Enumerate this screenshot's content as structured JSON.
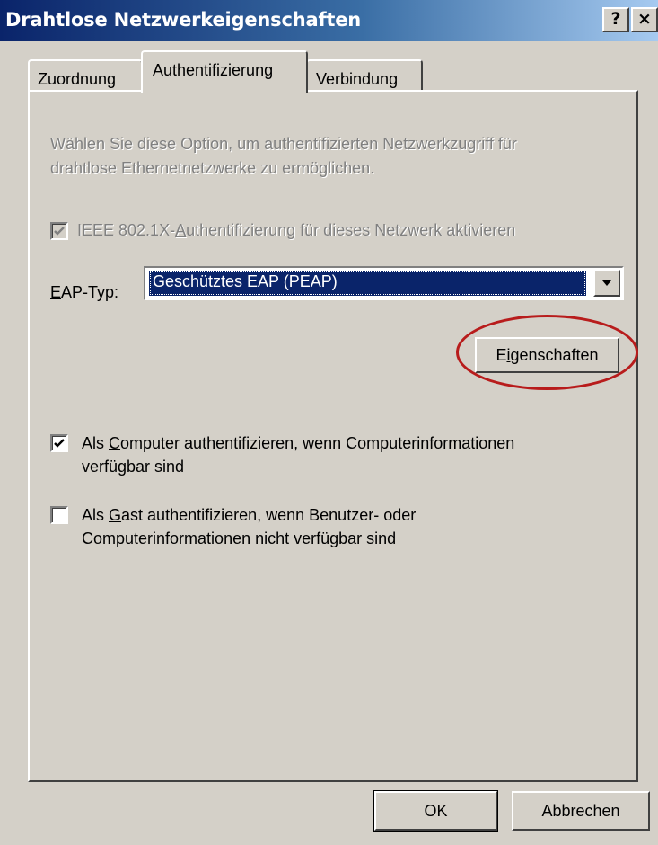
{
  "window": {
    "title": "Drahtlose Netzwerkeigenschaften",
    "help_button": "?",
    "close_button": "×"
  },
  "tabs": [
    {
      "label": "Zuordnung",
      "active": false
    },
    {
      "label": "Authentifizierung",
      "active": true
    },
    {
      "label": "Verbindung",
      "active": false
    }
  ],
  "panel": {
    "description_line1": "Wählen Sie diese Option, um authentifizierten Netzwerkzugriff für",
    "description_line2": "drahtlose Ethernetnetzwerke zu ermöglichen.",
    "ieee_checkbox": {
      "label_pre": "IEEE 802.1X-",
      "label_access": "A",
      "label_post": "uthentifizierung für dieses Netzwerk aktivieren",
      "checked": true,
      "enabled": false
    },
    "eap_type": {
      "label_access": "E",
      "label_post": "AP-Typ:",
      "selected_value": "Geschütztes EAP (PEAP)"
    },
    "properties_button": {
      "label_pre": "E",
      "label_access": "i",
      "label_post": "genschaften"
    },
    "computer_checkbox": {
      "line1_pre": "Als ",
      "line1_access": "C",
      "line1_post": "omputer authentifizieren, wenn Computerinformationen",
      "line2": "verfügbar sind",
      "checked": true
    },
    "guest_checkbox": {
      "line1_pre": "Als ",
      "line1_access": "G",
      "line1_post": "ast authentifizieren, wenn Benutzer- oder",
      "line2": "Computerinformationen nicht verfügbar sind",
      "checked": false
    }
  },
  "footer": {
    "ok_label": "OK",
    "cancel_label": "Abbrechen"
  },
  "annotation": {
    "highlight_color": "#b81c1c"
  },
  "colors": {
    "title_gradient_start": "#0a246a",
    "title_gradient_end": "#a6caf0",
    "dialog_face": "#d4d0c8",
    "selection": "#0a246a"
  }
}
